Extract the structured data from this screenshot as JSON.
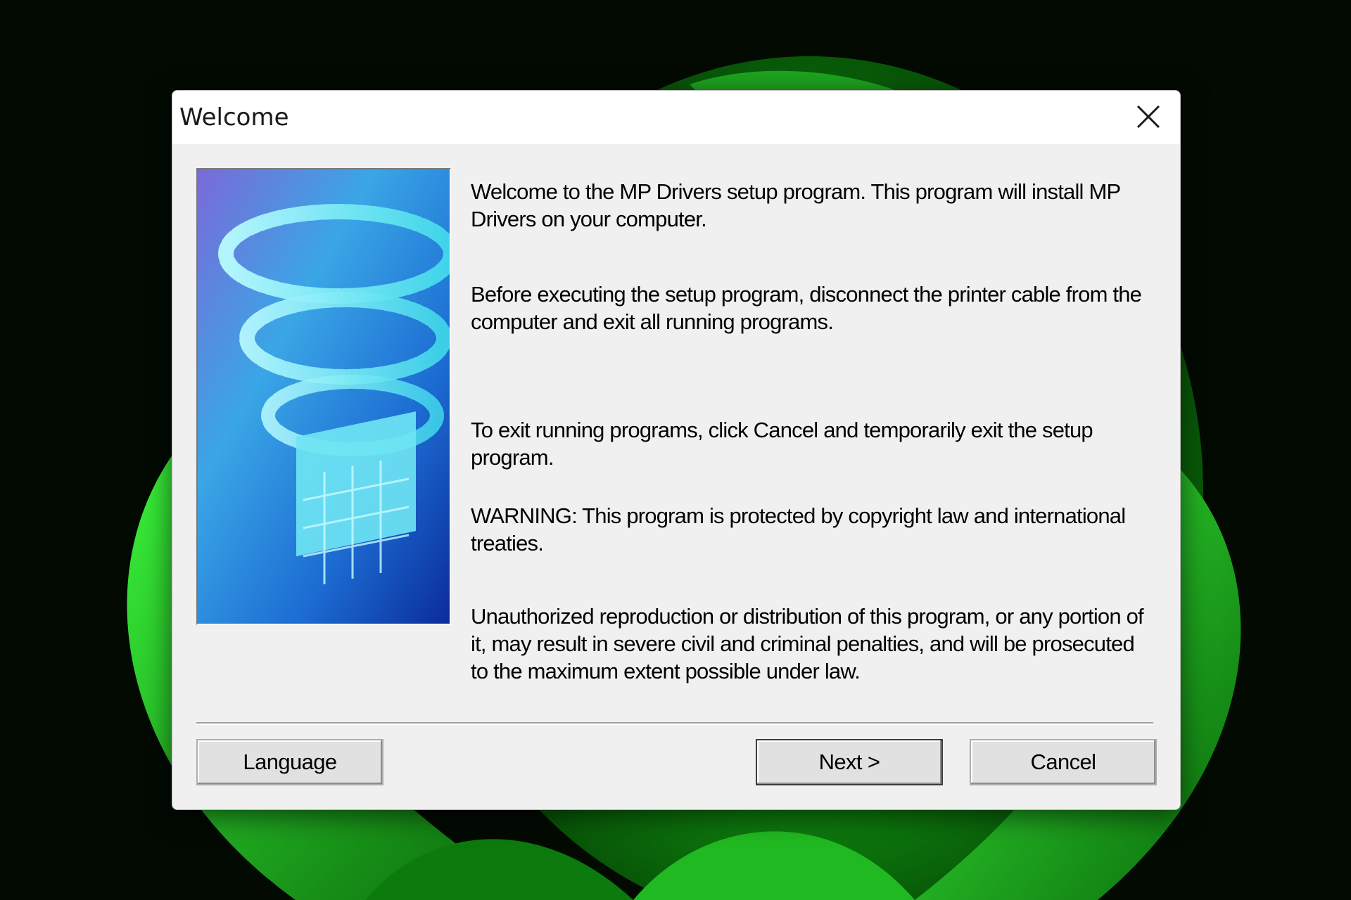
{
  "window": {
    "title": "Welcome"
  },
  "content": {
    "paragraphs": [
      "Welcome to the MP Drivers setup program. This program will install MP Drivers on your computer.",
      "Before executing the setup program, disconnect the printer cable from the computer and exit all running programs.",
      "To exit running programs, click Cancel and temporarily exit the setup program.",
      "WARNING: This program is protected by copyright law and international treaties.",
      "Unauthorized reproduction or distribution of this program, or any portion of it, may result in severe civil and criminal penalties, and will be prosecuted to the maximum extent possible under law."
    ]
  },
  "buttons": {
    "language": "Language",
    "next": "Next >",
    "cancel": "Cancel"
  },
  "icons": {
    "close": "close-icon",
    "hero": "setup-banner-image"
  },
  "colors": {
    "wallpaper_green": "#1fc21f",
    "banner_blue": "#1f6fd6",
    "banner_cyan": "#5fe8f4"
  }
}
